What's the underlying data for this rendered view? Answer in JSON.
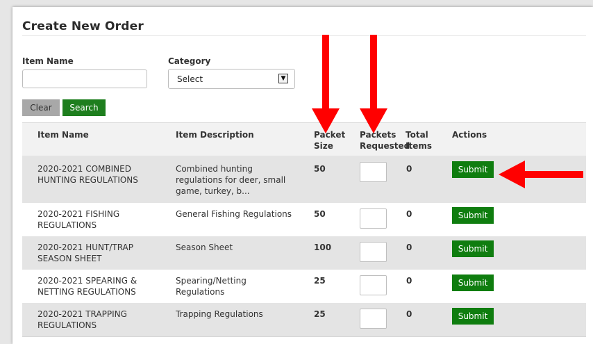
{
  "page": {
    "title": "Create New Order"
  },
  "filters": {
    "item_name_label": "Item Name",
    "item_name_value": "",
    "item_name_placeholder": "",
    "category_label": "Category",
    "category_selected": "Select",
    "clear_label": "Clear",
    "search_label": "Search"
  },
  "table": {
    "headers": {
      "item_name": "Item Name",
      "item_description": "Item Description",
      "packet_size_1": "Packet",
      "packet_size_2": "Size",
      "packets_requested_1": "Packets",
      "packets_requested_2": "Requested",
      "total_items_1": "Total",
      "total_items_2": "Items",
      "actions": "Actions"
    },
    "rows": [
      {
        "name_1": "2020-2021 COMBINED",
        "name_2": "HUNTING REGULATIONS",
        "desc_1": "Combined hunting",
        "desc_2": "regulations for deer, small",
        "desc_3": "game, turkey, b...",
        "packet_size": "50",
        "total": "0",
        "submit": "Submit"
      },
      {
        "name_1": "2020-2021 FISHING",
        "name_2": "REGULATIONS",
        "desc_1": "General Fishing Regulations",
        "desc_2": "",
        "desc_3": "",
        "packet_size": "50",
        "total": "0",
        "submit": "Submit"
      },
      {
        "name_1": "2020-2021 HUNT/TRAP",
        "name_2": "SEASON SHEET",
        "desc_1": "Season Sheet",
        "desc_2": "",
        "desc_3": "",
        "packet_size": "100",
        "total": "0",
        "submit": "Submit"
      },
      {
        "name_1": "2020-2021 SPEARING &",
        "name_2": "NETTING REGULATIONS",
        "desc_1": "Spearing/Netting",
        "desc_2": "Regulations",
        "desc_3": "",
        "packet_size": "25",
        "total": "0",
        "submit": "Submit"
      },
      {
        "name_1": "2020-2021 TRAPPING",
        "name_2": "REGULATIONS",
        "desc_1": "Trapping Regulations",
        "desc_2": "",
        "desc_3": "",
        "packet_size": "25",
        "total": "0",
        "submit": "Submit"
      }
    ]
  },
  "colors": {
    "accent_green": "#0f7d0f",
    "annotation_red": "#ff0000"
  },
  "icons": {
    "select_arrow": "chevron-down-icon",
    "annotation": "red-arrow-icon"
  }
}
